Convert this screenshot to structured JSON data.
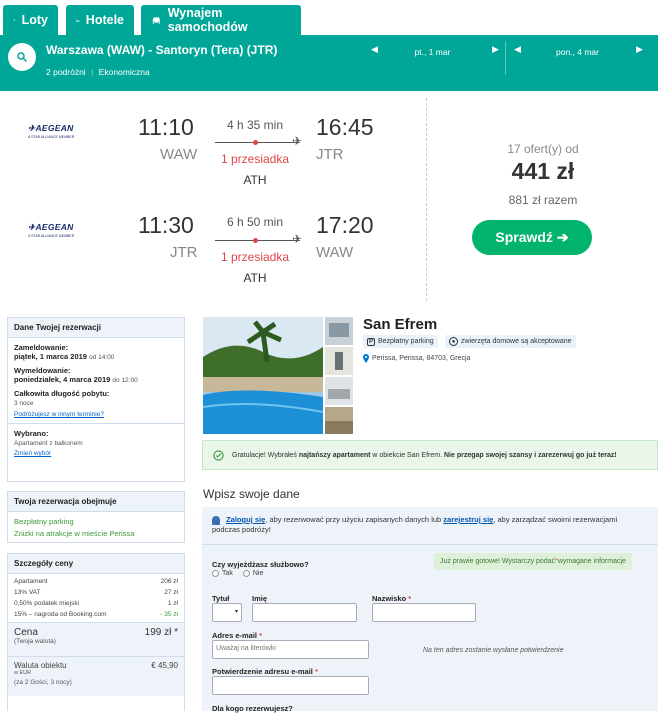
{
  "tabs": [
    {
      "label": "Loty"
    },
    {
      "label": "Hotele"
    },
    {
      "label": "Wynajem samochodów"
    }
  ],
  "search": {
    "route": "Warszawa (WAW) - Santoryn (Tera) (JTR)",
    "travelers": "2 podróżni",
    "cabin": "Ekonomiczna",
    "depart_date": "pt., 1 mar",
    "return_date": "pon., 4 mar"
  },
  "flights": [
    {
      "airline": "AEGEAN",
      "alliance": "A STAR ALLIANCE MEMBER",
      "dep_time": "11:10",
      "dep_code": "WAW",
      "duration": "4 h 35 min",
      "stops": "1 przesiadka",
      "via": "ATH",
      "arr_time": "16:45",
      "arr_code": "JTR"
    },
    {
      "airline": "AEGEAN",
      "alliance": "A STAR ALLIANCE MEMBER",
      "dep_time": "11:30",
      "dep_code": "JTR",
      "duration": "6 h 50 min",
      "stops": "1 przesiadka",
      "via": "ATH",
      "arr_time": "17:20",
      "arr_code": "WAW"
    }
  ],
  "offer": {
    "count": "17 ofert(y) od",
    "price": "441 zł",
    "total": "881 zł razem",
    "button": "Sprawdź ➔"
  },
  "reservation": {
    "header": "Dane Twojej rezerwacji",
    "checkin_label": "Zameldowanie:",
    "checkin_date": "piątek, 1 marca 2019",
    "checkin_time": "od 14:00",
    "checkout_label": "Wymeldowanie:",
    "checkout_date": "poniedziałek, 4 marca 2019",
    "checkout_time": "do 12:00",
    "length_label": "Całkowita długość pobytu:",
    "length_value": "3 noce",
    "other_dates_link": "Podróżujesz w innym terminie?",
    "selected_label": "Wybrano:",
    "selected_value": "Apartament z balkonem",
    "change_link": "Zmień wybór"
  },
  "includes": {
    "header": "Twoja rezerwacja obejmuje",
    "items": [
      "Bezpłatny parking",
      "Zniżki na atrakcje w mieście Perissa"
    ]
  },
  "price_details": {
    "header": "Szczegóły ceny",
    "rows": [
      {
        "label": "Apartament",
        "value": "206 zł"
      },
      {
        "label": "13% VAT",
        "value": "27 zł"
      },
      {
        "label": "0,50% podatek miejski",
        "value": "1 zł"
      },
      {
        "label": "15% – nagroda od Booking.com",
        "value": "- 35 zł"
      }
    ],
    "price_label": "Cena",
    "price_value": "199 zł *",
    "price_sub": "(Twoja waluta)",
    "local_label": "Waluta obiektu",
    "local_sub": "w EUR",
    "local_value": "€ 45,90",
    "footer": "(za 2 Gości, 3 nocy)"
  },
  "hotel": {
    "name": "San Efrem",
    "tag_parking": "Bezpłatny parking",
    "tag_pets": "zwierzęta domowe są akceptowane",
    "address": "Perissa, Perissa, 84703, Grecja"
  },
  "banner": {
    "pre": "Gratulacje! Wybrałeś ",
    "bold1": "najtańszy apartament",
    "mid": " w obiekcie San Efrem. ",
    "bold2": "Nie przegap swojej szansy i zarezerwuj go już teraz!"
  },
  "form": {
    "title": "Wpisz swoje dane",
    "login_link": "Zaloguj się",
    "login_mid": ", aby rezerwować przy użyciu zapisanych danych lub ",
    "register_link": "zarejestruj się",
    "login_end": ", aby zarządzać swoimi rezerwacjami podczas podróży!",
    "business_q": "Czy wyjeżdżasz służbowo?",
    "yes": "Tak",
    "no": "Nie",
    "ready_pre": "Już prawie gotowe! Wystarczy podać ",
    "ready_star": "*",
    "ready_post": " wymagane informacje",
    "title_label": "Tytuł",
    "first_label": "Imię",
    "last_label": "Nazwisko",
    "last_star": "*",
    "email_label": "Adres e-mail",
    "email_star": "*",
    "email_placeholder": "Uważaj na literówki",
    "email_note": "Na ten adres zostanie wysłane potwierdzenie",
    "confirm_label": "Potwierdzenie adresu e-mail",
    "confirm_star": "*",
    "for_whom": "Dla kogo rezerwujesz?"
  },
  "colors": {
    "brand": "#00a698",
    "cta": "#00b46e",
    "stop": "#e0454a",
    "panel": "#eef3fa"
  }
}
